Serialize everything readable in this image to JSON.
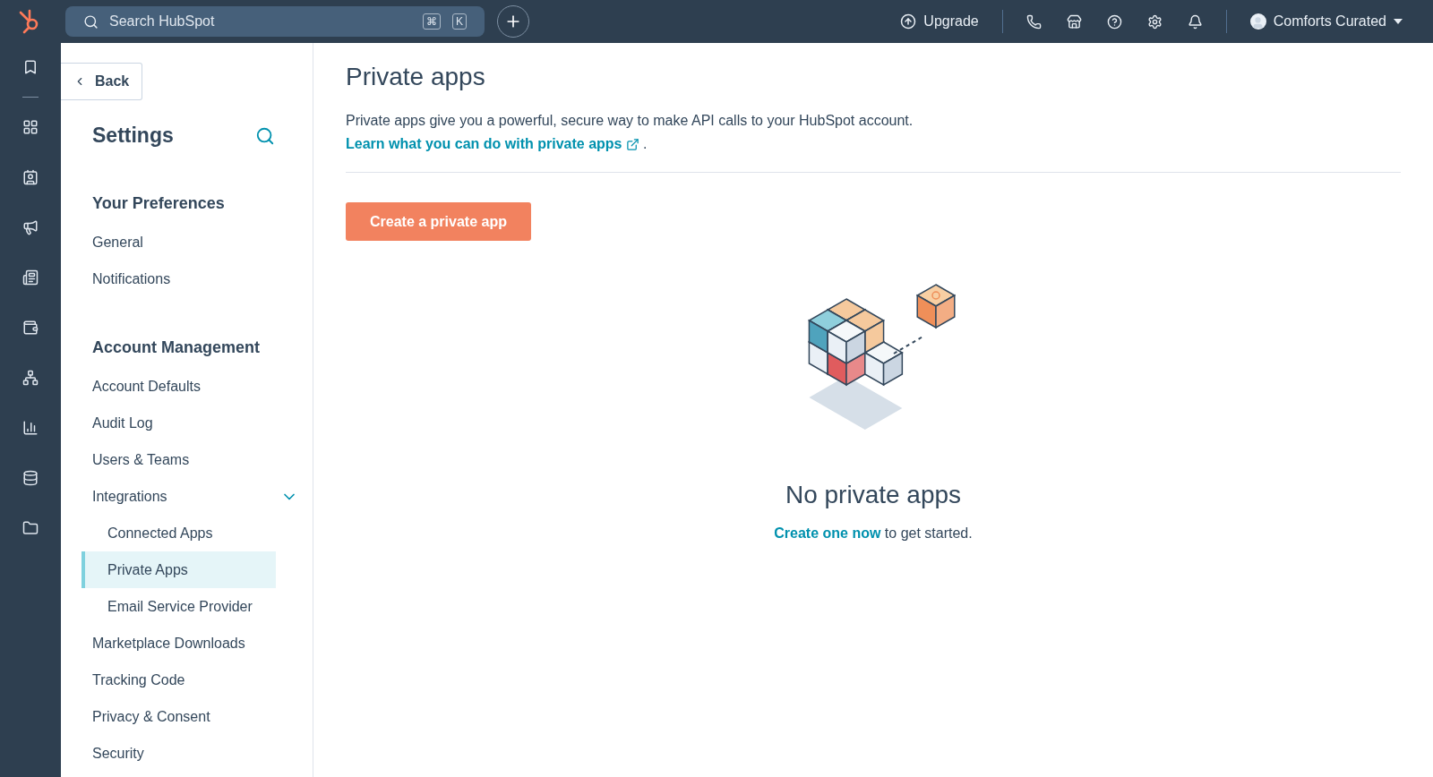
{
  "topbar": {
    "search": {
      "placeholder": "Search HubSpot",
      "keys": [
        "⌘",
        "K"
      ]
    },
    "upgrade": "Upgrade",
    "account": "Comforts Curated"
  },
  "sidebar": {
    "back": "Back",
    "title": "Settings",
    "sections": [
      {
        "heading": "Your Preferences",
        "items": [
          {
            "label": "General",
            "selected": false
          },
          {
            "label": "Notifications",
            "selected": false
          }
        ]
      },
      {
        "heading": "Account Management",
        "items": [
          {
            "label": "Account Defaults",
            "selected": false
          },
          {
            "label": "Audit Log",
            "selected": false
          },
          {
            "label": "Users & Teams",
            "selected": false
          },
          {
            "label": "Integrations",
            "selected": false,
            "expanded": true,
            "children": [
              {
                "label": "Connected Apps",
                "selected": false
              },
              {
                "label": "Private Apps",
                "selected": true
              },
              {
                "label": "Email Service Provider",
                "selected": false
              }
            ]
          },
          {
            "label": "Marketplace Downloads",
            "selected": false
          },
          {
            "label": "Tracking Code",
            "selected": false
          },
          {
            "label": "Privacy & Consent",
            "selected": false
          },
          {
            "label": "Security",
            "selected": false
          }
        ]
      }
    ]
  },
  "main": {
    "title": "Private apps",
    "description": "Private apps give you a powerful, secure way to make API calls to your HubSpot account.",
    "learn_link": "Learn what you can do with private apps",
    "learn_suffix": ".",
    "create_button": "Create a private app",
    "empty": {
      "title": "No private apps",
      "link": "Create one now",
      "text": " to get started."
    }
  }
}
